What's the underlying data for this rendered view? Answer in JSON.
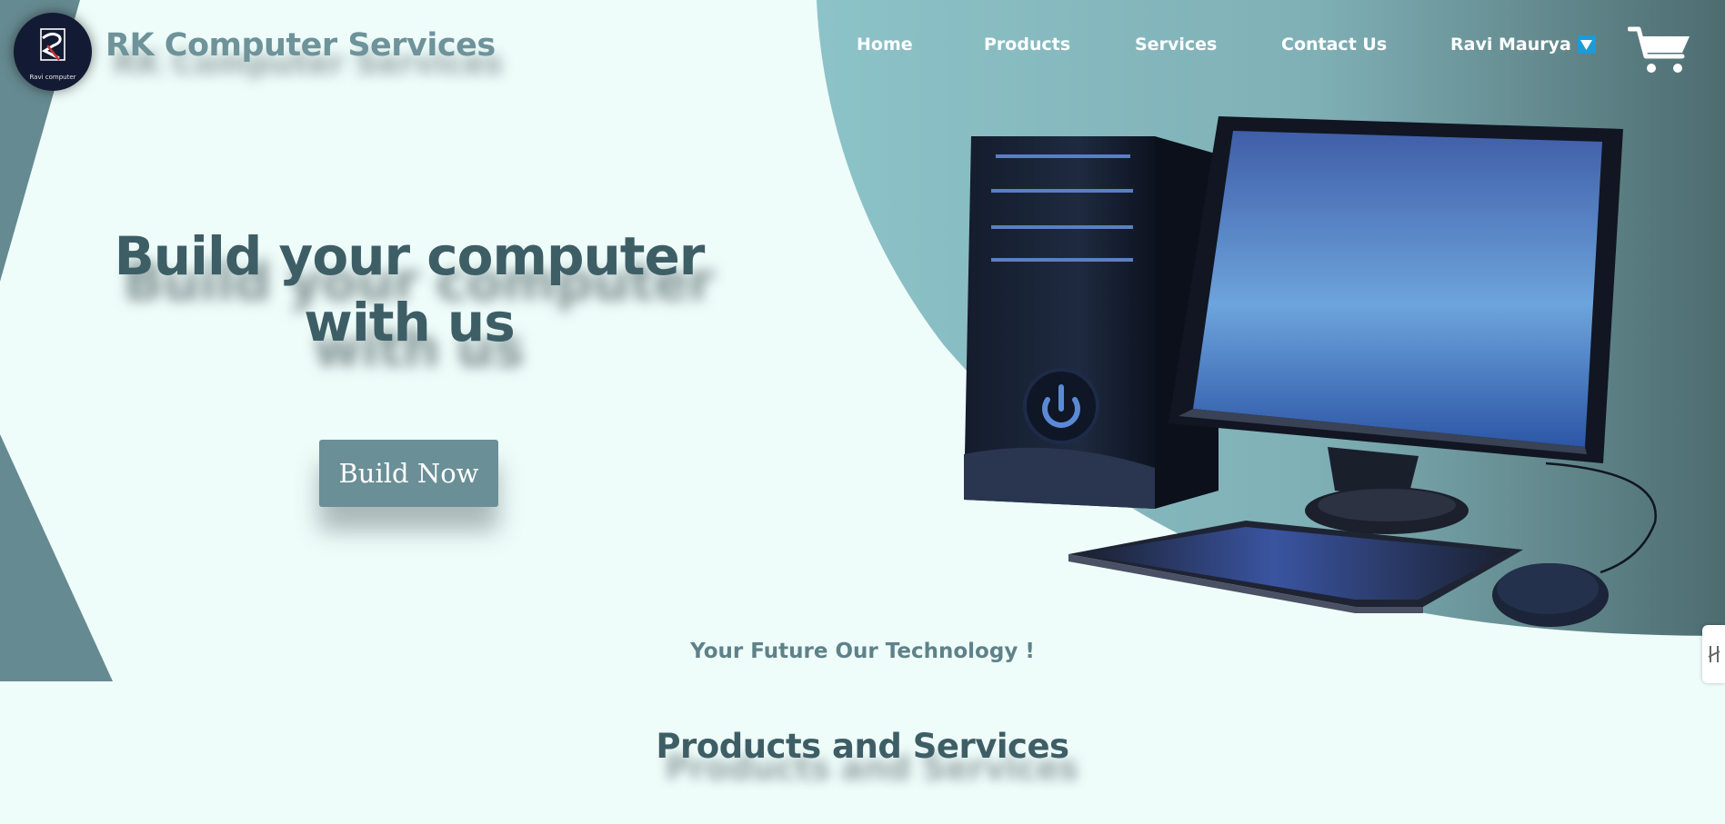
{
  "brand": {
    "name": "RK Computer Services",
    "logo_caption": "Ravi computer"
  },
  "nav": {
    "items": [
      {
        "label": "Home"
      },
      {
        "label": "Products"
      },
      {
        "label": "Services"
      },
      {
        "label": "Contact Us"
      }
    ],
    "user": {
      "name": "Ravi Maurya",
      "icon": "dropdown-arrow-icon"
    },
    "cart_icon": "cart-icon"
  },
  "hero": {
    "title_line1": "Build your computer",
    "title_line2": "with us",
    "cta_label": "Build Now",
    "illustration": "desktop-computer-illustration"
  },
  "tagline": "Your Future Our Technology !",
  "section_title": "Products and Services",
  "side_tab_icon": "side-tab-icon",
  "colors": {
    "background": "#effdfa",
    "teal_dark": "#3e5e66",
    "teal_mid": "#6a8f96",
    "teal_light": "#8cc3c8",
    "accent_blue": "#1d9bd8"
  }
}
